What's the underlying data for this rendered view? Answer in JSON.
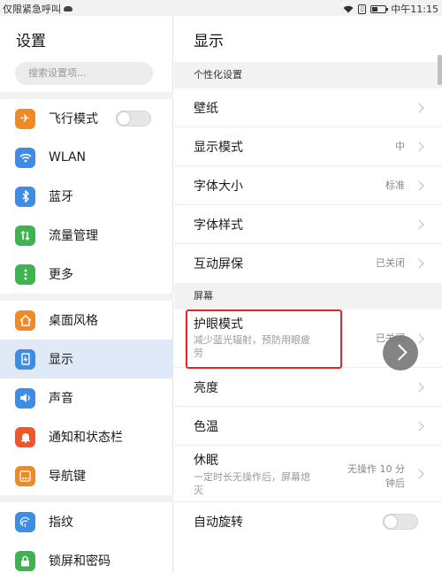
{
  "statusbar": {
    "carrier": "仅限紧急呼叫",
    "time": "中午11:15"
  },
  "sidebar": {
    "title": "设置",
    "search_placeholder": "搜索设置项...",
    "items": [
      {
        "label": "飞行模式",
        "icon": "airplane-icon",
        "color": "#f08a24"
      },
      {
        "label": "WLAN",
        "icon": "wifi-icon",
        "color": "#3d8ce6"
      },
      {
        "label": "蓝牙",
        "icon": "bluetooth-icon",
        "color": "#3d8ce6"
      },
      {
        "label": "流量管理",
        "icon": "data-usage-icon",
        "color": "#3fb34f"
      },
      {
        "label": "更多",
        "icon": "more-icon",
        "color": "#3fb34f"
      },
      {
        "label": "桌面风格",
        "icon": "home-icon",
        "color": "#f08a24"
      },
      {
        "label": "显示",
        "icon": "display-icon",
        "color": "#3d8ce6"
      },
      {
        "label": "声音",
        "icon": "sound-icon",
        "color": "#3d8ce6"
      },
      {
        "label": "通知和状态栏",
        "icon": "notification-icon",
        "color": "#f0562a"
      },
      {
        "label": "导航键",
        "icon": "navigation-icon",
        "color": "#f08a24"
      },
      {
        "label": "指纹",
        "icon": "fingerprint-icon",
        "color": "#3d8ce6"
      },
      {
        "label": "锁屏和密码",
        "icon": "lock-icon",
        "color": "#3fb34f"
      }
    ]
  },
  "main": {
    "title": "显示",
    "section_personal": "个性化设置",
    "section_screen": "屏幕",
    "rows": {
      "wallpaper": {
        "label": "壁纸"
      },
      "display_mode": {
        "label": "显示模式",
        "value": "中"
      },
      "font_size": {
        "label": "字体大小",
        "value": "标准"
      },
      "font_style": {
        "label": "字体样式"
      },
      "screensaver": {
        "label": "互动屏保",
        "value": "已关闭"
      },
      "eye_care": {
        "label": "护眼模式",
        "sub_line1": "减少蓝光辐射，预防用眼疲",
        "sub_line2": "劳",
        "value": "已关闭"
      },
      "brightness": {
        "label": "亮度"
      },
      "color_temp": {
        "label": "色温"
      },
      "sleep": {
        "label": "休眠",
        "sub_line1": "一定时长无操作后，屏幕熄",
        "sub_line2": "灭",
        "value_line1": "无操作 10 分",
        "value_line2": "钟后"
      },
      "auto_rotate": {
        "label": "自动旋转"
      }
    }
  },
  "accent": {
    "highlight": "#e0262b",
    "active_bg": "#dfe9f7"
  }
}
